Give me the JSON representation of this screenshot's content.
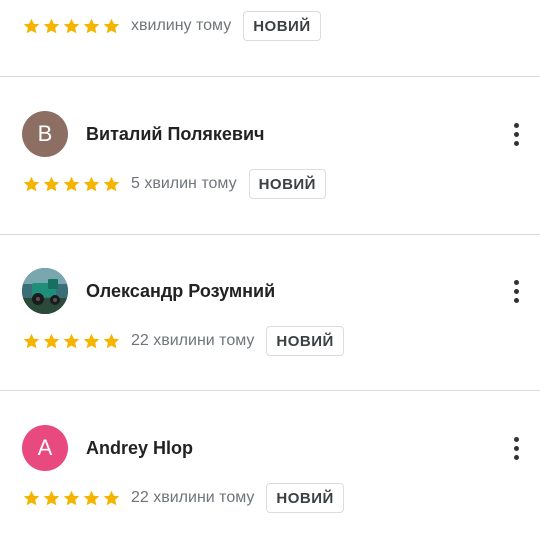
{
  "colors": {
    "star": "#f4b400",
    "divider": "#dcdcdc",
    "badge_border": "#dadce0"
  },
  "reviews": [
    {
      "author": "",
      "avatar_letter": "",
      "avatar_color": "",
      "rating": 5,
      "time": "хвилину тому",
      "badge": "НОВИЙ"
    },
    {
      "author": "Виталий Полякевич",
      "avatar_letter": "В",
      "avatar_color": "#8d6e63",
      "rating": 5,
      "time": "5 хвилин тому",
      "badge": "НОВИЙ"
    },
    {
      "author": "Олександр Розумний",
      "avatar_letter": "",
      "avatar_color": "#2f5d64",
      "avatar_icon": "photo-avatar-icon",
      "rating": 5,
      "time": "22 хвилини тому",
      "badge": "НОВИЙ"
    },
    {
      "author": "Andrey Hlop",
      "avatar_letter": "A",
      "avatar_color": "#e84a7f",
      "rating": 5,
      "time": "22 хвилини тому",
      "badge": "НОВИЙ"
    }
  ],
  "icons": {
    "star": "star-icon",
    "menu": "more-vert-icon"
  }
}
